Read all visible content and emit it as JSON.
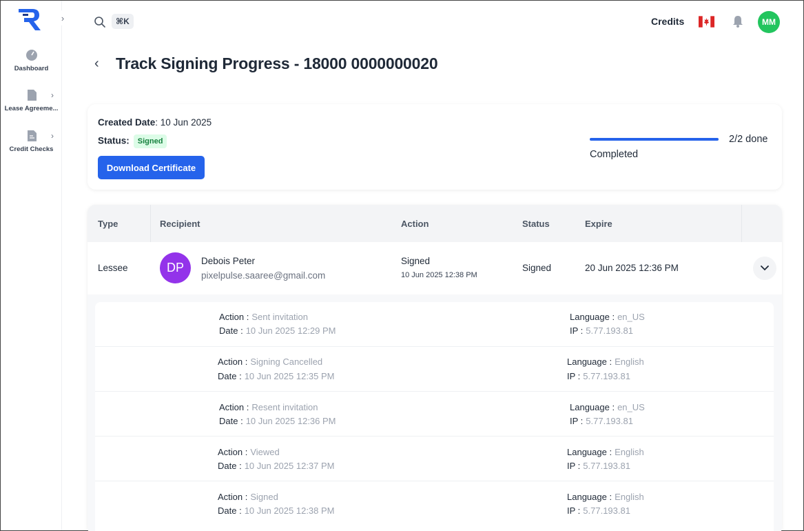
{
  "sidebar": {
    "items": [
      {
        "label": "Dashboard",
        "icon": "gauge-icon"
      },
      {
        "label": "Lease Agreeme...",
        "icon": "document-icon"
      },
      {
        "label": "Credit Checks",
        "icon": "file-text-icon"
      }
    ]
  },
  "topbar": {
    "shortcut": "⌘K",
    "credits_label": "Credits",
    "avatar_initials": "MM"
  },
  "page": {
    "title": "Track Signing Progress - 18000 0000000020"
  },
  "summary": {
    "created_label": "Created Date",
    "created_value": ": 10 Jun 2025",
    "status_label": "Status:",
    "status_value": "Signed",
    "download_label": "Download Certificate",
    "progress_count": "2/2 done",
    "progress_fraction": 1.0,
    "progress_label": "Completed"
  },
  "table": {
    "columns": [
      "Type",
      "Recipient",
      "Action",
      "Status",
      "Expire"
    ],
    "row": {
      "type": "Lessee",
      "initials": "DP",
      "name": "Debois Peter",
      "email": "pixelpulse.saaree@gmail.com",
      "action": "Signed",
      "action_date": "10 Jun 2025 12:38 PM",
      "status": "Signed",
      "expire": "20 Jun 2025 12:36 PM"
    }
  },
  "events_labels": {
    "action": "Action :",
    "date": "Date :",
    "language": "Language :",
    "ip": "IP :"
  },
  "events": [
    {
      "action": "Sent invitation",
      "date": "10 Jun 2025 12:29 PM",
      "language": "en_US",
      "ip": "5.77.193.81"
    },
    {
      "action": "Signing Cancelled",
      "date": "10 Jun 2025 12:35 PM",
      "language": "English",
      "ip": "5.77.193.81"
    },
    {
      "action": "Resent invitation",
      "date": "10 Jun 2025 12:36 PM",
      "language": "en_US",
      "ip": "5.77.193.81"
    },
    {
      "action": "Viewed",
      "date": "10 Jun 2025 12:37 PM",
      "language": "English",
      "ip": "5.77.193.81"
    },
    {
      "action": "Signed",
      "date": "10 Jun 2025 12:38 PM",
      "language": "English",
      "ip": "5.77.193.81"
    }
  ],
  "colors": {
    "primary": "#2563eb",
    "success_bg": "#dcfce7",
    "success_text": "#15803d",
    "avatar_user": "#22c55e",
    "avatar_recipient": "#9333ea"
  }
}
